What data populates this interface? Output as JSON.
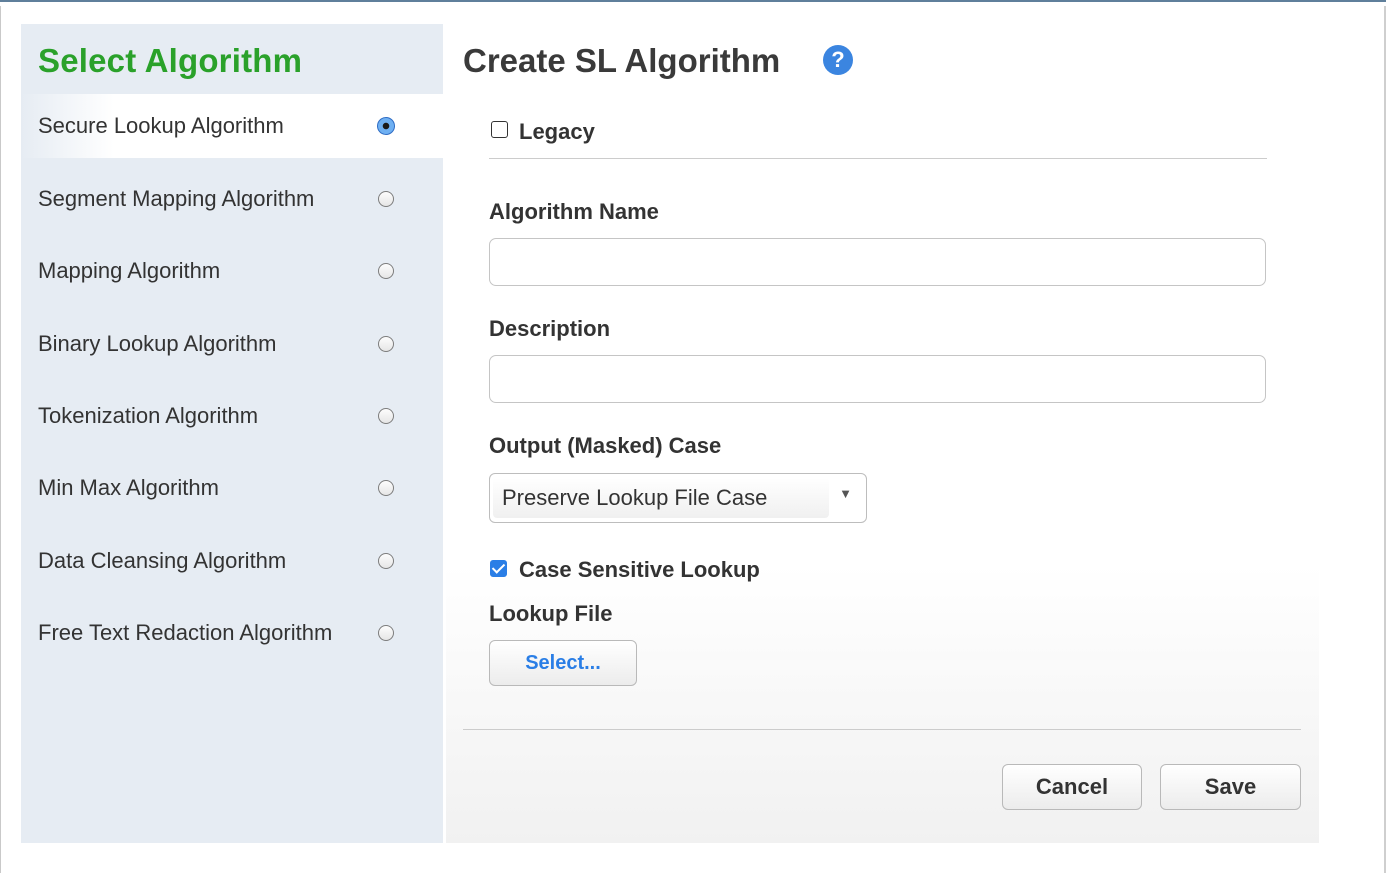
{
  "sidebar": {
    "title": "Select Algorithm",
    "items": [
      {
        "label": "Secure Lookup Algorithm",
        "selected": true
      },
      {
        "label": "Segment Mapping Algorithm",
        "selected": false
      },
      {
        "label": "Mapping Algorithm",
        "selected": false
      },
      {
        "label": "Binary Lookup Algorithm",
        "selected": false
      },
      {
        "label": "Tokenization Algorithm",
        "selected": false
      },
      {
        "label": "Min Max Algorithm",
        "selected": false
      },
      {
        "label": "Data Cleansing Algorithm",
        "selected": false
      },
      {
        "label": "Free Text Redaction Algorithm",
        "selected": false
      }
    ]
  },
  "form": {
    "title": "Create SL Algorithm",
    "help_icon": "?",
    "legacy": {
      "label": "Legacy",
      "checked": false
    },
    "name_label": "Algorithm Name",
    "name_value": "",
    "description_label": "Description",
    "description_value": "",
    "case_label": "Output (Masked) Case",
    "case_value": "Preserve Lookup File Case",
    "case_sensitive": {
      "label": "Case Sensitive Lookup",
      "checked": true
    },
    "lookup_label": "Lookup File",
    "select_button": "Select...",
    "cancel_button": "Cancel",
    "save_button": "Save"
  },
  "colors": {
    "sidebar_bg": "#e6ecf3",
    "title_green": "#2aa12a",
    "accent_blue": "#2a7ee6"
  }
}
